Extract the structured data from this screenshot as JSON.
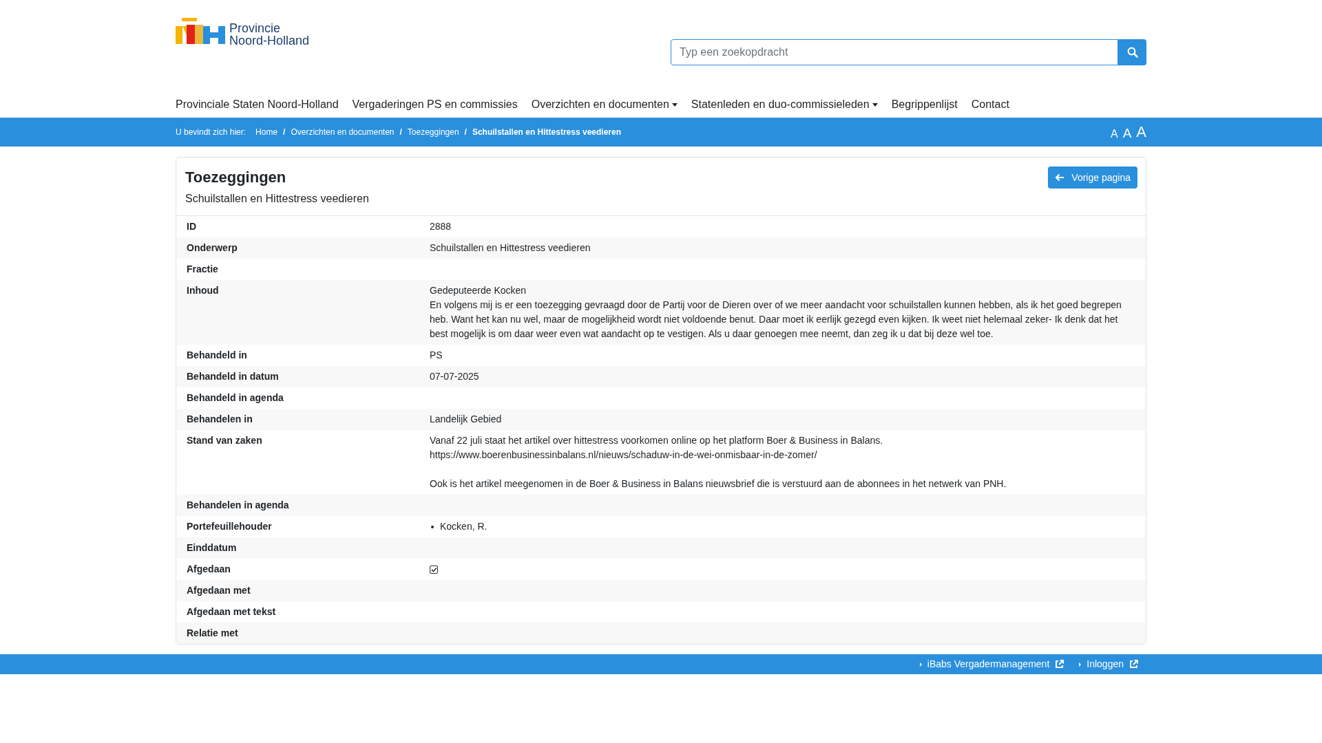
{
  "logo": {
    "lines": [
      "Provincie",
      "Noord-Holland"
    ]
  },
  "search": {
    "placeholder": "Typ een zoekopdracht"
  },
  "nav": [
    {
      "label": "Provinciale Staten Noord-Holland",
      "dropdown": false
    },
    {
      "label": "Vergaderingen PS en commissies",
      "dropdown": false
    },
    {
      "label": "Overzichten en documenten",
      "dropdown": true
    },
    {
      "label": "Statenleden en duo-commissieleden",
      "dropdown": true
    },
    {
      "label": "Begrippenlijst",
      "dropdown": false
    },
    {
      "label": "Contact",
      "dropdown": false
    }
  ],
  "breadcrumb": {
    "prefix": "U bevindt zich hier:",
    "items": [
      "Home",
      "Overzichten en documenten",
      "Toezeggingen",
      "Schuilstallen en Hittestress veedieren"
    ],
    "separator": "/"
  },
  "text_size": [
    "A",
    "A",
    "A"
  ],
  "card": {
    "title": "Toezeggingen",
    "subtitle": "Schuilstallen en Hittestress veedieren",
    "back_button": "Vorige pagina"
  },
  "rows": [
    {
      "label": "ID",
      "kind": "text",
      "value": "2888"
    },
    {
      "label": "Onderwerp",
      "kind": "text",
      "value": "Schuilstallen en Hittestress veedieren"
    },
    {
      "label": "Fractie",
      "kind": "empty"
    },
    {
      "label": "Inhoud",
      "kind": "paragraphs",
      "paragraphs": [
        [
          "Gedeputeerde Kocken",
          "En volgens mij is er een toezegging gevraagd door de Partij voor de Dieren over of we meer aandacht voor schuilstallen kunnen hebben, als ik het goed begrepen heb. Want het kan nu wel, maar de mogelijkheid wordt niet voldoende benut. Daar moet ik eerlijk gezegd even kijken. Ik weet niet helemaal zeker- Ik denk dat het best mogelijk is om daar weer even wat aandacht op te vestigen. Als u daar genoegen mee neemt, dan zeg ik u dat bij deze wel toe."
        ]
      ]
    },
    {
      "label": "Behandeld in",
      "kind": "text",
      "value": "PS"
    },
    {
      "label": "Behandeld in datum",
      "kind": "text",
      "value": "07-07-2025"
    },
    {
      "label": "Behandeld in agenda",
      "kind": "empty"
    },
    {
      "label": "Behandelen in",
      "kind": "text",
      "value": "Landelijk Gebied"
    },
    {
      "label": "Stand van zaken",
      "kind": "paragraphs",
      "paragraphs": [
        [
          "Vanaf 22 juli staat het artikel over hittestress voorkomen online op het platform Boer & Business in Balans.",
          "https://www.boerenbusinessinbalans.nl/nieuws/schaduw-in-de-wei-onmisbaar-in-de-zomer/"
        ],
        [
          "Ook is het artikel meegenomen in de Boer & Business in Balans nieuwsbrief die is verstuurd aan de abonnees in het netwerk van PNH."
        ]
      ]
    },
    {
      "label": "Behandelen in agenda",
      "kind": "empty"
    },
    {
      "label": "Portefeuillehouder",
      "kind": "list",
      "items": [
        "Kocken, R."
      ]
    },
    {
      "label": "Einddatum",
      "kind": "empty"
    },
    {
      "label": "Afgedaan",
      "kind": "checkbox",
      "checked": true
    },
    {
      "label": "Afgedaan met",
      "kind": "empty"
    },
    {
      "label": "Afgedaan met tekst",
      "kind": "empty"
    },
    {
      "label": "Relatie met",
      "kind": "empty"
    }
  ],
  "footer_links": [
    "iBabs Vergadermanagement",
    "Inloggen"
  ]
}
